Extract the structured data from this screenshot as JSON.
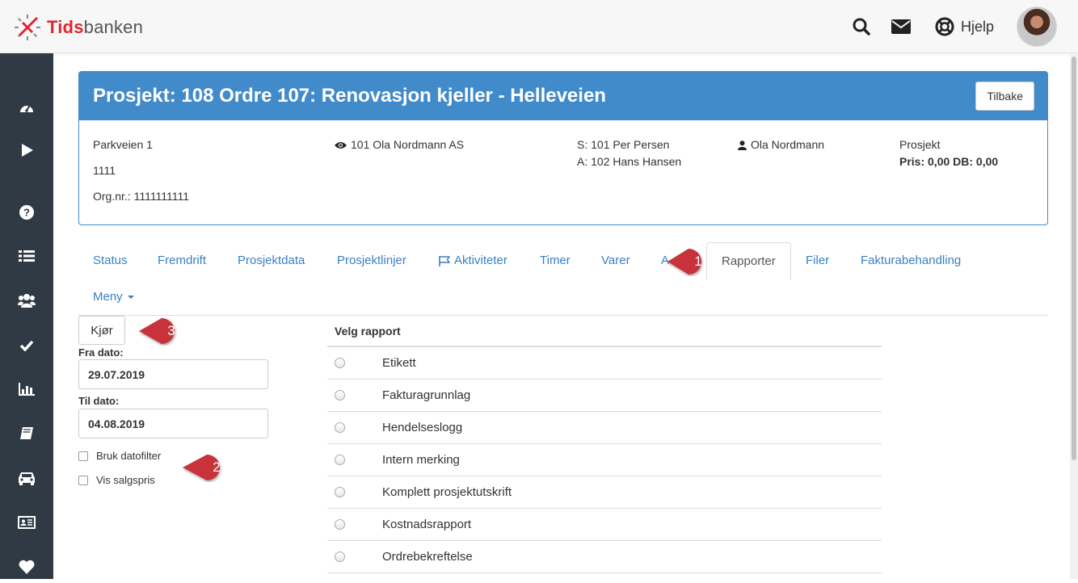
{
  "app": {
    "logo_bold": "Tids",
    "logo_rest": "banken"
  },
  "topbar": {
    "help_label": "Hjelp"
  },
  "sidebar": {
    "items": [
      {
        "icon": "dashboard-icon"
      },
      {
        "icon": "play-icon"
      },
      {
        "icon": "question-icon"
      },
      {
        "icon": "list-icon"
      },
      {
        "icon": "users-icon"
      },
      {
        "icon": "check-icon"
      },
      {
        "icon": "bar-chart-icon"
      },
      {
        "icon": "book-icon"
      },
      {
        "icon": "car-icon"
      },
      {
        "icon": "id-card-icon"
      },
      {
        "icon": "heart-icon"
      }
    ]
  },
  "project": {
    "title": "Prosjekt: 108 Ordre 107: Renovasjon kjeller - Helleveien",
    "back_label": "Tilbake",
    "address": "Parkveien 1",
    "postal": "1111",
    "orgnr": "Org.nr.: 1111111111",
    "customer": "101 Ola Nordmann AS",
    "s_person": "S: 101 Per Persen",
    "a_person": "A: 102 Hans Hansen",
    "contact": "Ola Nordmann",
    "type": "Prosjekt",
    "price": "Pris: 0,00 DB: 0,00"
  },
  "tabs": {
    "status": "Status",
    "fremdrift": "Fremdrift",
    "prosjektdata": "Prosjektdata",
    "prosjektlinjer": "Prosjektlinjer",
    "aktiviteter": "Aktiviteter",
    "timer": "Timer",
    "varer": "Varer",
    "hidden": "A",
    "rapporter": "Rapporter",
    "filer": "Filer",
    "fakturabehandling": "Fakturabehandling",
    "meny": "Meny"
  },
  "markers": {
    "m1": "1",
    "m2": "2",
    "m3": "3"
  },
  "form": {
    "run_label": "Kjør",
    "from_label": "Fra dato:",
    "from_value": "29.07.2019",
    "to_label": "Til dato:",
    "to_value": "04.08.2019",
    "cb_datefilter": "Bruk datofilter",
    "cb_salesprice": "Vis salgspris"
  },
  "reports": {
    "header": "Velg rapport",
    "items": [
      "Etikett",
      "Fakturagrunnlag",
      "Hendelseslogg",
      "Intern merking",
      "Komplett prosjektutskrift",
      "Kostnadsrapport",
      "Ordrebekreftelse"
    ]
  },
  "colors": {
    "brand_red": "#e0262e",
    "panel_blue": "#428bca",
    "sidebar": "#2f3a45",
    "marker_red": "#c7313b"
  }
}
